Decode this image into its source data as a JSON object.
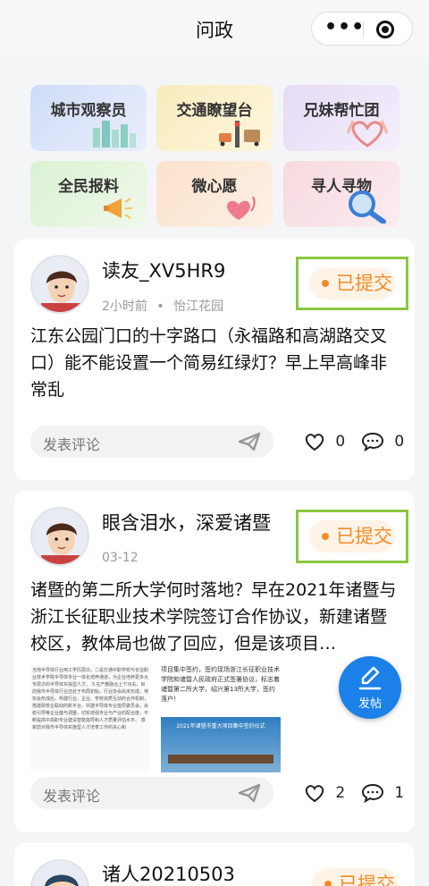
{
  "header": {
    "title": "问政",
    "menu_icon": "more-dots-icon",
    "close_icon": "target-icon"
  },
  "categories": [
    {
      "label": "城市观察员",
      "icon": "city-buildings-icon",
      "color": "#dde6fa"
    },
    {
      "label": "交通瞭望台",
      "icon": "traffic-tower-icon",
      "color": "#fbf1cd"
    },
    {
      "label": "兄妹帮忙团",
      "icon": "heart-hands-icon",
      "color": "#ece3f8"
    },
    {
      "label": "全民报料",
      "icon": "megaphone-icon",
      "color": "#e4f5de"
    },
    {
      "label": "微心愿",
      "icon": "heart-balloon-icon",
      "color": "#fde9d8"
    },
    {
      "label": "寻人寻物",
      "icon": "magnifier-icon",
      "color": "#f8e1e6"
    }
  ],
  "posts": [
    {
      "username": "读友_XV5HR9",
      "time": "2小时前",
      "location": "怡江花园",
      "status": "已提交",
      "content": "江东公园门口的十字路口（永福路和高湖路交叉口）能不能设置一个简易红绿灯？早上早高峰非常乱",
      "comment_placeholder": "发表评论",
      "likes": "0",
      "comments": "0"
    },
    {
      "username": "眼含泪水，深爱诸暨",
      "time": "03-12",
      "status": "已提交",
      "content": "诸暨的第二所大学何时落地？早在2021年诸暨与浙江长征职业技术学院签订合作协议，新建诸暨校区，教体局也做了回应，但是该项目…",
      "image1_text": "当地半导体行业用工学历层次。二是打通中职学校与长征职业技术学院半导体专业一体化培养通道，为企业培养更多大专层次的半导体实操型人才。 3.在产教融合上下功夫。目前我市半导体行业还处于布局初始，行业协会尚未形成，待协会形成后，构建行业、企业、学校资质互动的合作机制，搭建政校企联动的新平台，共建半导体专业指导委员会，会稳引导等企业盛与调整，切实增强专业与产业的配合度，不断提高中高职专业建设智能指导和人才质量评估水平。 感谢您对我市半导体实施型人才培育工作的关心和",
      "image2_text": "项目集中签约，签约现场浙江长征职业技术学院和诸暨人民政府正式签署协议，标志着诸暨第二所大学，绍兴第13所大学，签约落户！",
      "image2_banner": "2021年诸暨市重大项目集中签约仪式",
      "comment_placeholder": "发表评论",
      "likes": "2",
      "comments": "1"
    },
    {
      "username": "诸人20210503",
      "status": "已提交"
    }
  ],
  "fab": {
    "label": "发帖",
    "icon": "edit-icon"
  }
}
